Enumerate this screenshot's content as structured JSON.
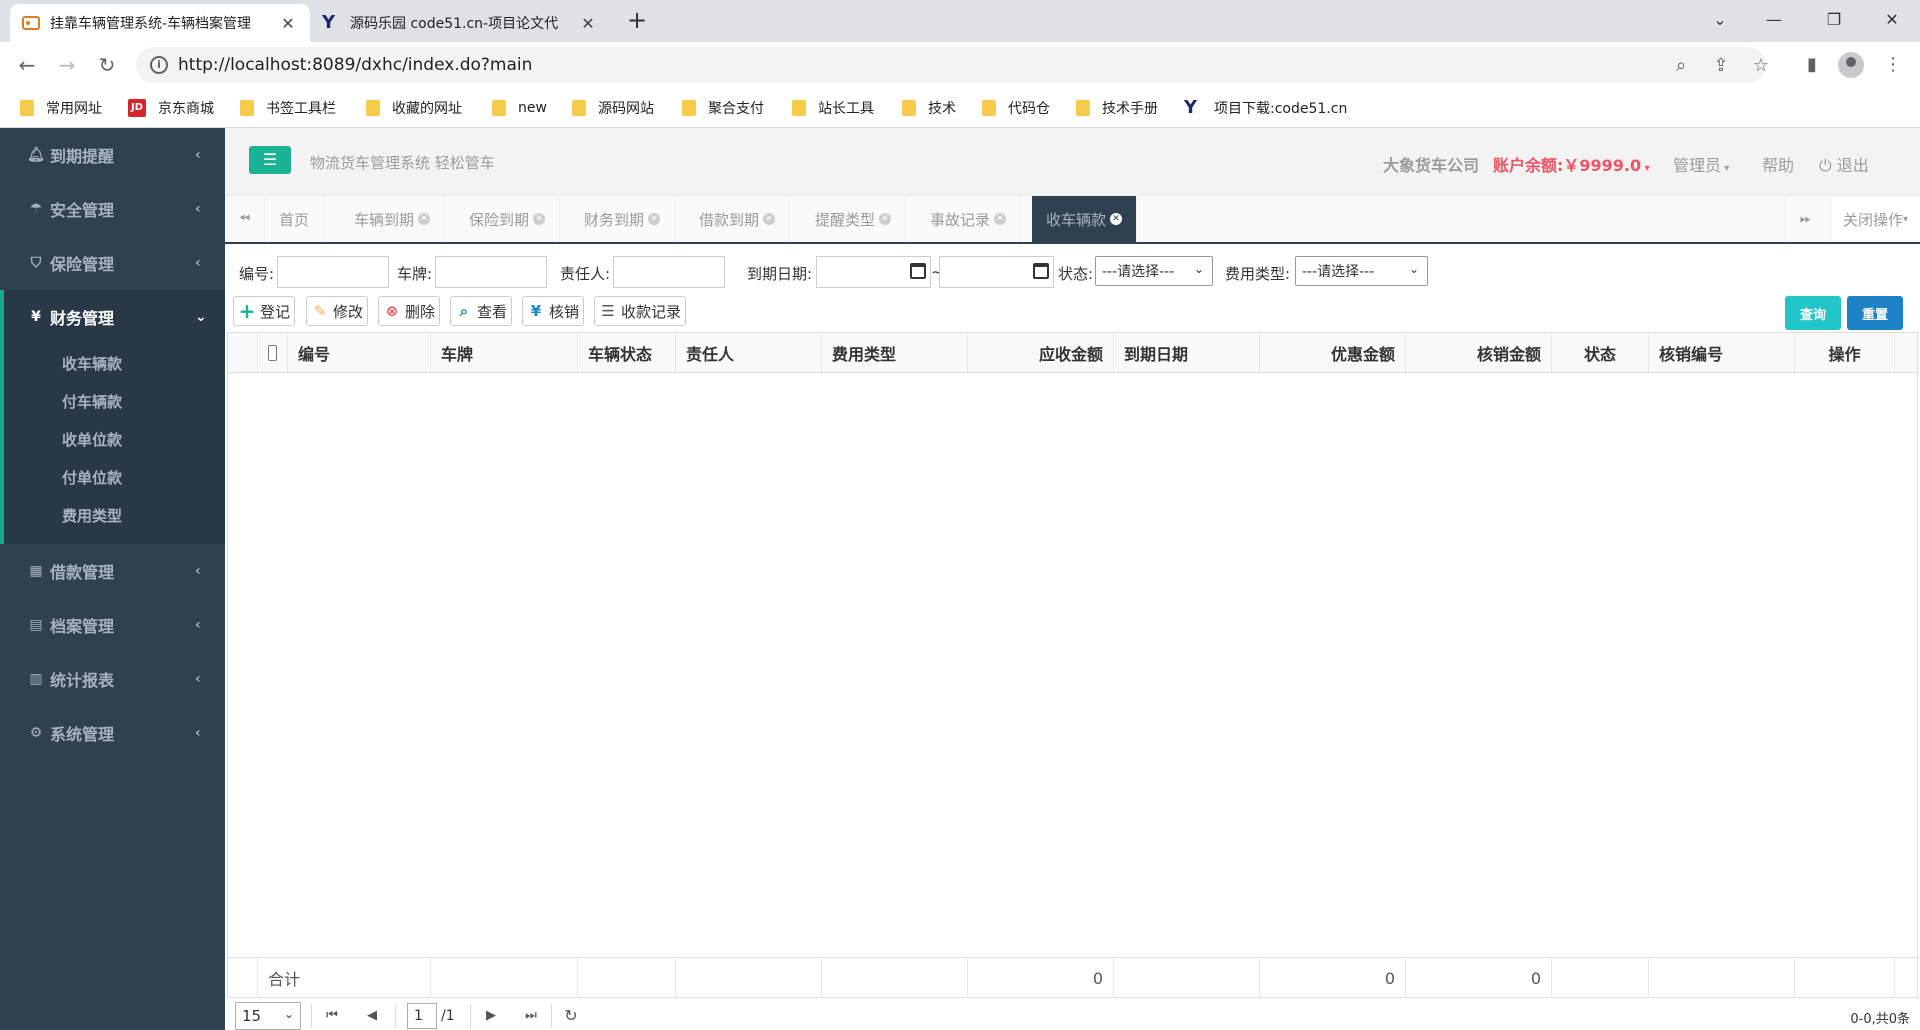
{
  "browser": {
    "tabs": [
      {
        "title": "挂靠车辆管理系统-车辆档案管理",
        "active": true
      },
      {
        "title": "源码乐园 code51.cn-项目论文代",
        "active": false
      }
    ],
    "url": "http://localhost:8089/dxhc/index.do?main",
    "bookmarks": [
      "常用网址",
      "京东商城",
      "书签工具栏",
      "收藏的网址",
      "new",
      "源码网站",
      "聚合支付",
      "站长工具",
      "技术",
      "代码仓",
      "技术手册",
      "项目下载:code51.cn"
    ]
  },
  "sidebar": {
    "items": [
      {
        "label": "到期提醒",
        "icon": "bell-icon"
      },
      {
        "label": "安全管理",
        "icon": "umbrella-icon"
      },
      {
        "label": "保险管理",
        "icon": "shield-icon"
      },
      {
        "label": "财务管理",
        "icon": "yen-icon",
        "active": true
      },
      {
        "label": "借款管理",
        "icon": "calculator-icon"
      },
      {
        "label": "档案管理",
        "icon": "file-icon"
      },
      {
        "label": "统计报表",
        "icon": "bar-chart-icon"
      },
      {
        "label": "系统管理",
        "icon": "gear-icon"
      }
    ],
    "submenu": [
      "收车辆款",
      "付车辆款",
      "收单位款",
      "付单位款",
      "费用类型"
    ]
  },
  "header": {
    "slogan": "物流货车管理系统 轻松管车",
    "company": "大象货车公司",
    "balance": "账户余额:￥9999.0",
    "admin": "管理员",
    "help": "帮助",
    "logout": "退出"
  },
  "pagetabs": {
    "tabs": [
      "首页",
      "车辆到期",
      "保险到期",
      "财务到期",
      "借款到期",
      "提醒类型",
      "事故记录",
      "收车辆款"
    ],
    "close_ops": "关闭操作"
  },
  "search": {
    "code_label": "编号:",
    "plate_label": "车牌:",
    "person_label": "责任人:",
    "due_label": "到期日期:",
    "tilde": "~",
    "status_label": "状态:",
    "status_value": "---请选择---",
    "fee_label": "费用类型:",
    "fee_value": "---请选择---"
  },
  "toolbar": {
    "add": "登记",
    "edit": "修改",
    "delete": "删除",
    "view": "查看",
    "verify": "核销",
    "records": "收款记录",
    "query": "查询",
    "reset": "重置"
  },
  "table": {
    "columns": [
      "编号",
      "车牌",
      "车辆状态",
      "责任人",
      "费用类型",
      "应收金额",
      "到期日期",
      "优惠金额",
      "核销金额",
      "状态",
      "核销编号",
      "操作"
    ],
    "footer": {
      "label": "合计",
      "receivable": "0",
      "discount": "0",
      "verified": "0"
    }
  },
  "pager": {
    "page_size": "15",
    "page": "1",
    "total_pages": "/1",
    "info": "0-0,共0条"
  },
  "colors": {
    "sidebar": "#2f4050",
    "accent": "#1ab394",
    "danger": "#ed5565",
    "info_btn": "#23c6c8",
    "primary_btn": "#1c84c6"
  }
}
